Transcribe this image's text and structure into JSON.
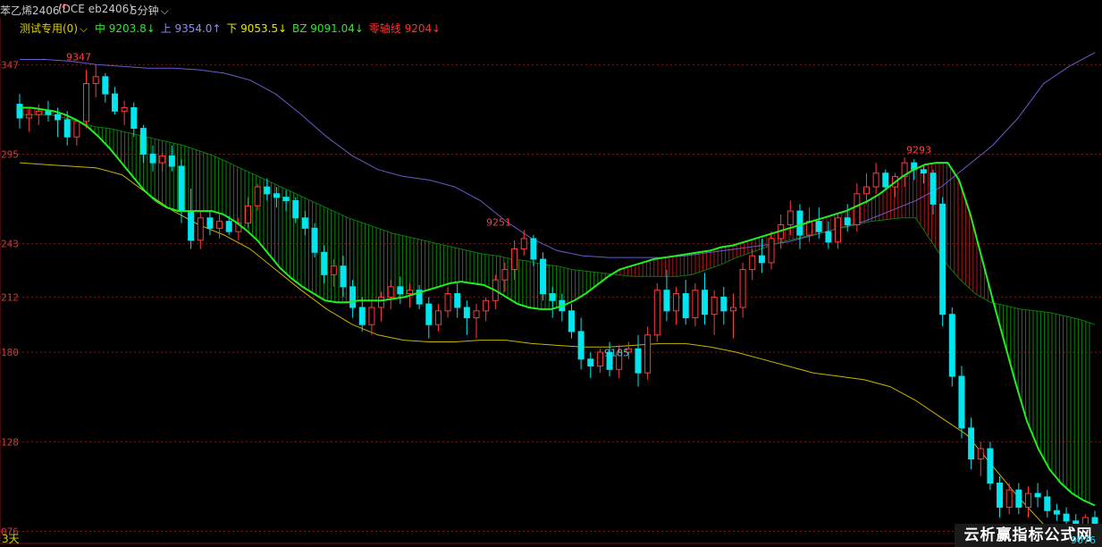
{
  "header": {
    "instrument": "苯乙烯2406",
    "instrument_marker": "M",
    "code": "(DCE eb2406)",
    "period": "5分钟",
    "period_chevron": "chevron-down-icon"
  },
  "indicator": {
    "name": "测试专用(0)",
    "mid_label": "中 9203.8↓",
    "up_label": "上 9354.0↑",
    "down_label": "下 9053.5↓",
    "bz_label": "BZ 9091.04↓",
    "zero_label": "零轴线 9204↓",
    "colors": {
      "name": "#d8d000",
      "mid": "#2ee82e",
      "up": "#8080ff",
      "down": "#e8e800",
      "bz": "#2ee82e",
      "zero": "#ff3030"
    }
  },
  "colors": {
    "up_candle": "#ff3b3b",
    "down_candle": "#00e5ee",
    "mid_line": "#22ee22",
    "upper_band": "#6a5acd",
    "lower_band": "#c8b400",
    "fill_bull": "#0e9a0e",
    "fill_bear": "#c81c1c",
    "grid": "#7a1a1a",
    "axis_text": "#c83c3c"
  },
  "chart_data": {
    "type": "candlestick",
    "yrange": [
      9070,
      9370
    ],
    "y_ticks": [
      "347",
      "295",
      "243",
      "212",
      "180",
      "128",
      "076"
    ],
    "y_tick_values": [
      9347,
      9295,
      9243,
      9212,
      9180,
      9128,
      9076
    ],
    "annotations": [
      {
        "text": "9347",
        "value": 9347,
        "color": "#ff4040"
      },
      {
        "text": "9251",
        "value": 9251,
        "color": "#ff4040"
      },
      {
        "text": "9185",
        "value": 9185,
        "color": "#35d0e8"
      },
      {
        "text": "9293",
        "value": 9293,
        "color": "#ff4040"
      },
      {
        "text": "9076",
        "value": 9076,
        "color": "#35d0e8"
      }
    ],
    "candles": [
      [
        9324,
        9330,
        9310,
        9316
      ],
      [
        9316,
        9322,
        9308,
        9318
      ],
      [
        9318,
        9324,
        9312,
        9320
      ],
      [
        9320,
        9326,
        9314,
        9318
      ],
      [
        9318,
        9322,
        9305,
        9315
      ],
      [
        9315,
        9320,
        9300,
        9305
      ],
      [
        9305,
        9315,
        9300,
        9314
      ],
      [
        9314,
        9344,
        9310,
        9336
      ],
      [
        9336,
        9347,
        9328,
        9340
      ],
      [
        9340,
        9342,
        9325,
        9330
      ],
      [
        9330,
        9334,
        9318,
        9320
      ],
      [
        9320,
        9326,
        9312,
        9322
      ],
      [
        9322,
        9325,
        9305,
        9310
      ],
      [
        9310,
        9312,
        9290,
        9295
      ],
      [
        9295,
        9300,
        9285,
        9290
      ],
      [
        9290,
        9296,
        9285,
        9294
      ],
      [
        9294,
        9300,
        9285,
        9288
      ],
      [
        9288,
        9292,
        9255,
        9262
      ],
      [
        9262,
        9275,
        9240,
        9245
      ],
      [
        9245,
        9262,
        9240,
        9258
      ],
      [
        9258,
        9262,
        9248,
        9252
      ],
      [
        9252,
        9260,
        9246,
        9256
      ],
      [
        9256,
        9259,
        9248,
        9250
      ],
      [
        9250,
        9258,
        9245,
        9255
      ],
      [
        9255,
        9270,
        9252,
        9265
      ],
      [
        9265,
        9278,
        9262,
        9276
      ],
      [
        9276,
        9281,
        9268,
        9272
      ],
      [
        9272,
        9276,
        9264,
        9270
      ],
      [
        9270,
        9274,
        9262,
        9268
      ],
      [
        9268,
        9270,
        9255,
        9258
      ],
      [
        9258,
        9262,
        9248,
        9252
      ],
      [
        9252,
        9255,
        9235,
        9238
      ],
      [
        9238,
        9242,
        9220,
        9225
      ],
      [
        9225,
        9234,
        9218,
        9230
      ],
      [
        9230,
        9236,
        9212,
        9218
      ],
      [
        9218,
        9222,
        9200,
        9206
      ],
      [
        9206,
        9212,
        9192,
        9196
      ],
      [
        9196,
        9210,
        9190,
        9206
      ],
      [
        9206,
        9215,
        9198,
        9212
      ],
      [
        9212,
        9222,
        9205,
        9218
      ],
      [
        9218,
        9224,
        9208,
        9214
      ],
      [
        9214,
        9220,
        9206,
        9216
      ],
      [
        9216,
        9219,
        9205,
        9208
      ],
      [
        9208,
        9212,
        9188,
        9196
      ],
      [
        9196,
        9208,
        9192,
        9204
      ],
      [
        9204,
        9218,
        9200,
        9214
      ],
      [
        9214,
        9220,
        9200,
        9206
      ],
      [
        9206,
        9210,
        9190,
        9200
      ],
      [
        9200,
        9208,
        9188,
        9204
      ],
      [
        9204,
        9212,
        9198,
        9210
      ],
      [
        9210,
        9225,
        9205,
        9222
      ],
      [
        9222,
        9232,
        9215,
        9228
      ],
      [
        9228,
        9245,
        9222,
        9240
      ],
      [
        9240,
        9251,
        9236,
        9246
      ],
      [
        9246,
        9248,
        9230,
        9234
      ],
      [
        9234,
        9238,
        9210,
        9214
      ],
      [
        9214,
        9218,
        9200,
        9210
      ],
      [
        9210,
        9214,
        9198,
        9204
      ],
      [
        9204,
        9208,
        9188,
        9192
      ],
      [
        9192,
        9200,
        9170,
        9176
      ],
      [
        9176,
        9180,
        9165,
        9172
      ],
      [
        9172,
        9182,
        9168,
        9180
      ],
      [
        9180,
        9186,
        9166,
        9170
      ],
      [
        9170,
        9184,
        9165,
        9180
      ],
      [
        9180,
        9186,
        9176,
        9182
      ],
      [
        9182,
        9190,
        9160,
        9168
      ],
      [
        9168,
        9195,
        9164,
        9190
      ],
      [
        9190,
        9220,
        9186,
        9216
      ],
      [
        9216,
        9228,
        9198,
        9204
      ],
      [
        9204,
        9218,
        9196,
        9214
      ],
      [
        9214,
        9222,
        9196,
        9200
      ],
      [
        9200,
        9220,
        9195,
        9216
      ],
      [
        9216,
        9226,
        9196,
        9202
      ],
      [
        9202,
        9216,
        9190,
        9212
      ],
      [
        9212,
        9218,
        9196,
        9204
      ],
      [
        9204,
        9214,
        9188,
        9206
      ],
      [
        9206,
        9232,
        9200,
        9228
      ],
      [
        9228,
        9240,
        9222,
        9236
      ],
      [
        9236,
        9246,
        9226,
        9232
      ],
      [
        9232,
        9250,
        9228,
        9246
      ],
      [
        9246,
        9260,
        9240,
        9254
      ],
      [
        9254,
        9268,
        9248,
        9262
      ],
      [
        9262,
        9266,
        9240,
        9248
      ],
      [
        9248,
        9264,
        9244,
        9256
      ],
      [
        9256,
        9264,
        9246,
        9250
      ],
      [
        9250,
        9256,
        9240,
        9244
      ],
      [
        9244,
        9260,
        9240,
        9258
      ],
      [
        9258,
        9266,
        9250,
        9254
      ],
      [
        9254,
        9278,
        9250,
        9272
      ],
      [
        9272,
        9284,
        9266,
        9276
      ],
      [
        9276,
        9290,
        9272,
        9284
      ],
      [
        9284,
        9286,
        9274,
        9276
      ],
      [
        9276,
        9284,
        9270,
        9282
      ],
      [
        9282,
        9293,
        9276,
        9290
      ],
      [
        9290,
        9292,
        9280,
        9286
      ],
      [
        9286,
        9288,
        9278,
        9284
      ],
      [
        9284,
        9286,
        9260,
        9266
      ],
      [
        9266,
        9270,
        9195,
        9202
      ],
      [
        9202,
        9206,
        9160,
        9166
      ],
      [
        9166,
        9172,
        9130,
        9136
      ],
      [
        9136,
        9142,
        9112,
        9118
      ],
      [
        9118,
        9128,
        9108,
        9124
      ],
      [
        9124,
        9128,
        9100,
        9104
      ],
      [
        9104,
        9108,
        9084,
        9090
      ],
      [
        9090,
        9104,
        9086,
        9100
      ],
      [
        9100,
        9104,
        9086,
        9090
      ],
      [
        9090,
        9102,
        9084,
        9098
      ],
      [
        9098,
        9104,
        9090,
        9096
      ],
      [
        9096,
        9100,
        9084,
        9088
      ],
      [
        9088,
        9092,
        9082,
        9086
      ],
      [
        9086,
        9090,
        9078,
        9082
      ],
      [
        9082,
        9086,
        9076,
        9078
      ],
      [
        9078,
        9086,
        9074,
        9084
      ],
      [
        9084,
        9088,
        9078,
        9080
      ]
    ],
    "series": [
      {
        "name": "中",
        "values": [
          9322,
          9322,
          9321,
          9320,
          9318,
          9315,
          9311,
          9305,
          9298,
          9290,
          9282,
          9274,
          9268,
          9264,
          9262,
          9262,
          9262,
          9262,
          9260,
          9256,
          9251,
          9245,
          9237,
          9229,
          9223,
          9218,
          9214,
          9210,
          9209,
          9209,
          9210,
          9210,
          9210,
          9211,
          9212,
          9214,
          9216,
          9218,
          9220,
          9221,
          9220,
          9219,
          9216,
          9212,
          9208,
          9206,
          9205,
          9205,
          9207,
          9210,
          9214,
          9219,
          9224,
          9228,
          9230,
          9232,
          9234,
          9235,
          9236,
          9237,
          9238,
          9239,
          9241,
          9242,
          9244,
          9246,
          9248,
          9250,
          9252,
          9254,
          9256,
          9258,
          9260,
          9262,
          9265,
          9268,
          9272,
          9277,
          9282,
          9286,
          9289,
          9290,
          9290,
          9280,
          9260,
          9235,
          9210,
          9186,
          9162,
          9140,
          9124,
          9112,
          9104,
          9098,
          9094,
          9091
        ]
      },
      {
        "name": "上",
        "values": [
          9350,
          9350,
          9349,
          9347,
          9346,
          9345,
          9345,
          9344,
          9342,
          9338,
          9330,
          9318,
          9305,
          9294,
          9286,
          9282,
          9280,
          9276,
          9268,
          9256,
          9246,
          9239,
          9236,
          9235,
          9235,
          9235,
          9236,
          9238,
          9240,
          9242,
          9244,
          9248,
          9252,
          9256,
          9262,
          9268,
          9276,
          9288,
          9300,
          9316,
          9336,
          9346,
          9354
        ]
      },
      {
        "name": "下",
        "values": [
          9290,
          9289,
          9288,
          9287,
          9283,
          9272,
          9262,
          9254,
          9248,
          9240,
          9228,
          9216,
          9205,
          9196,
          9190,
          9187,
          9186,
          9186,
          9187,
          9187,
          9185,
          9184,
          9183,
          9183,
          9184,
          9185,
          9185,
          9183,
          9180,
          9176,
          9172,
          9168,
          9166,
          9164,
          9160,
          9152,
          9142,
          9132,
          9114,
          9096,
          9080,
          9070,
          9062
        ]
      },
      {
        "name": "BZ",
        "values": [
          9318,
          9318,
          9318,
          9316,
          9314,
          9311,
          9310,
          9308,
          9306,
          9304,
          9302,
          9300,
          9297,
          9294,
          9290,
          9286,
          9282,
          9278,
          9274,
          9270,
          9266,
          9262,
          9258,
          9255,
          9252,
          9249,
          9247,
          9245,
          9243,
          9241,
          9239,
          9237,
          9236,
          9234,
          9233,
          9231,
          9230,
          9228,
          9227,
          9226,
          9225,
          9224,
          9224,
          9224,
          9224,
          9225,
          9228,
          9231,
          9235,
          9238,
          9241,
          9244,
          9246,
          9248,
          9250,
          9252,
          9254,
          9256,
          9257,
          9258,
          9258,
          9245,
          9232,
          9222,
          9214,
          9209,
          9207,
          9205,
          9204,
          9203,
          9201,
          9199,
          9196
        ]
      }
    ],
    "legend": "top-left",
    "grid": true
  },
  "footer": {
    "period_tag": "3天",
    "watermark": "云析赢指标公式网",
    "watermark_sub": "9076"
  }
}
